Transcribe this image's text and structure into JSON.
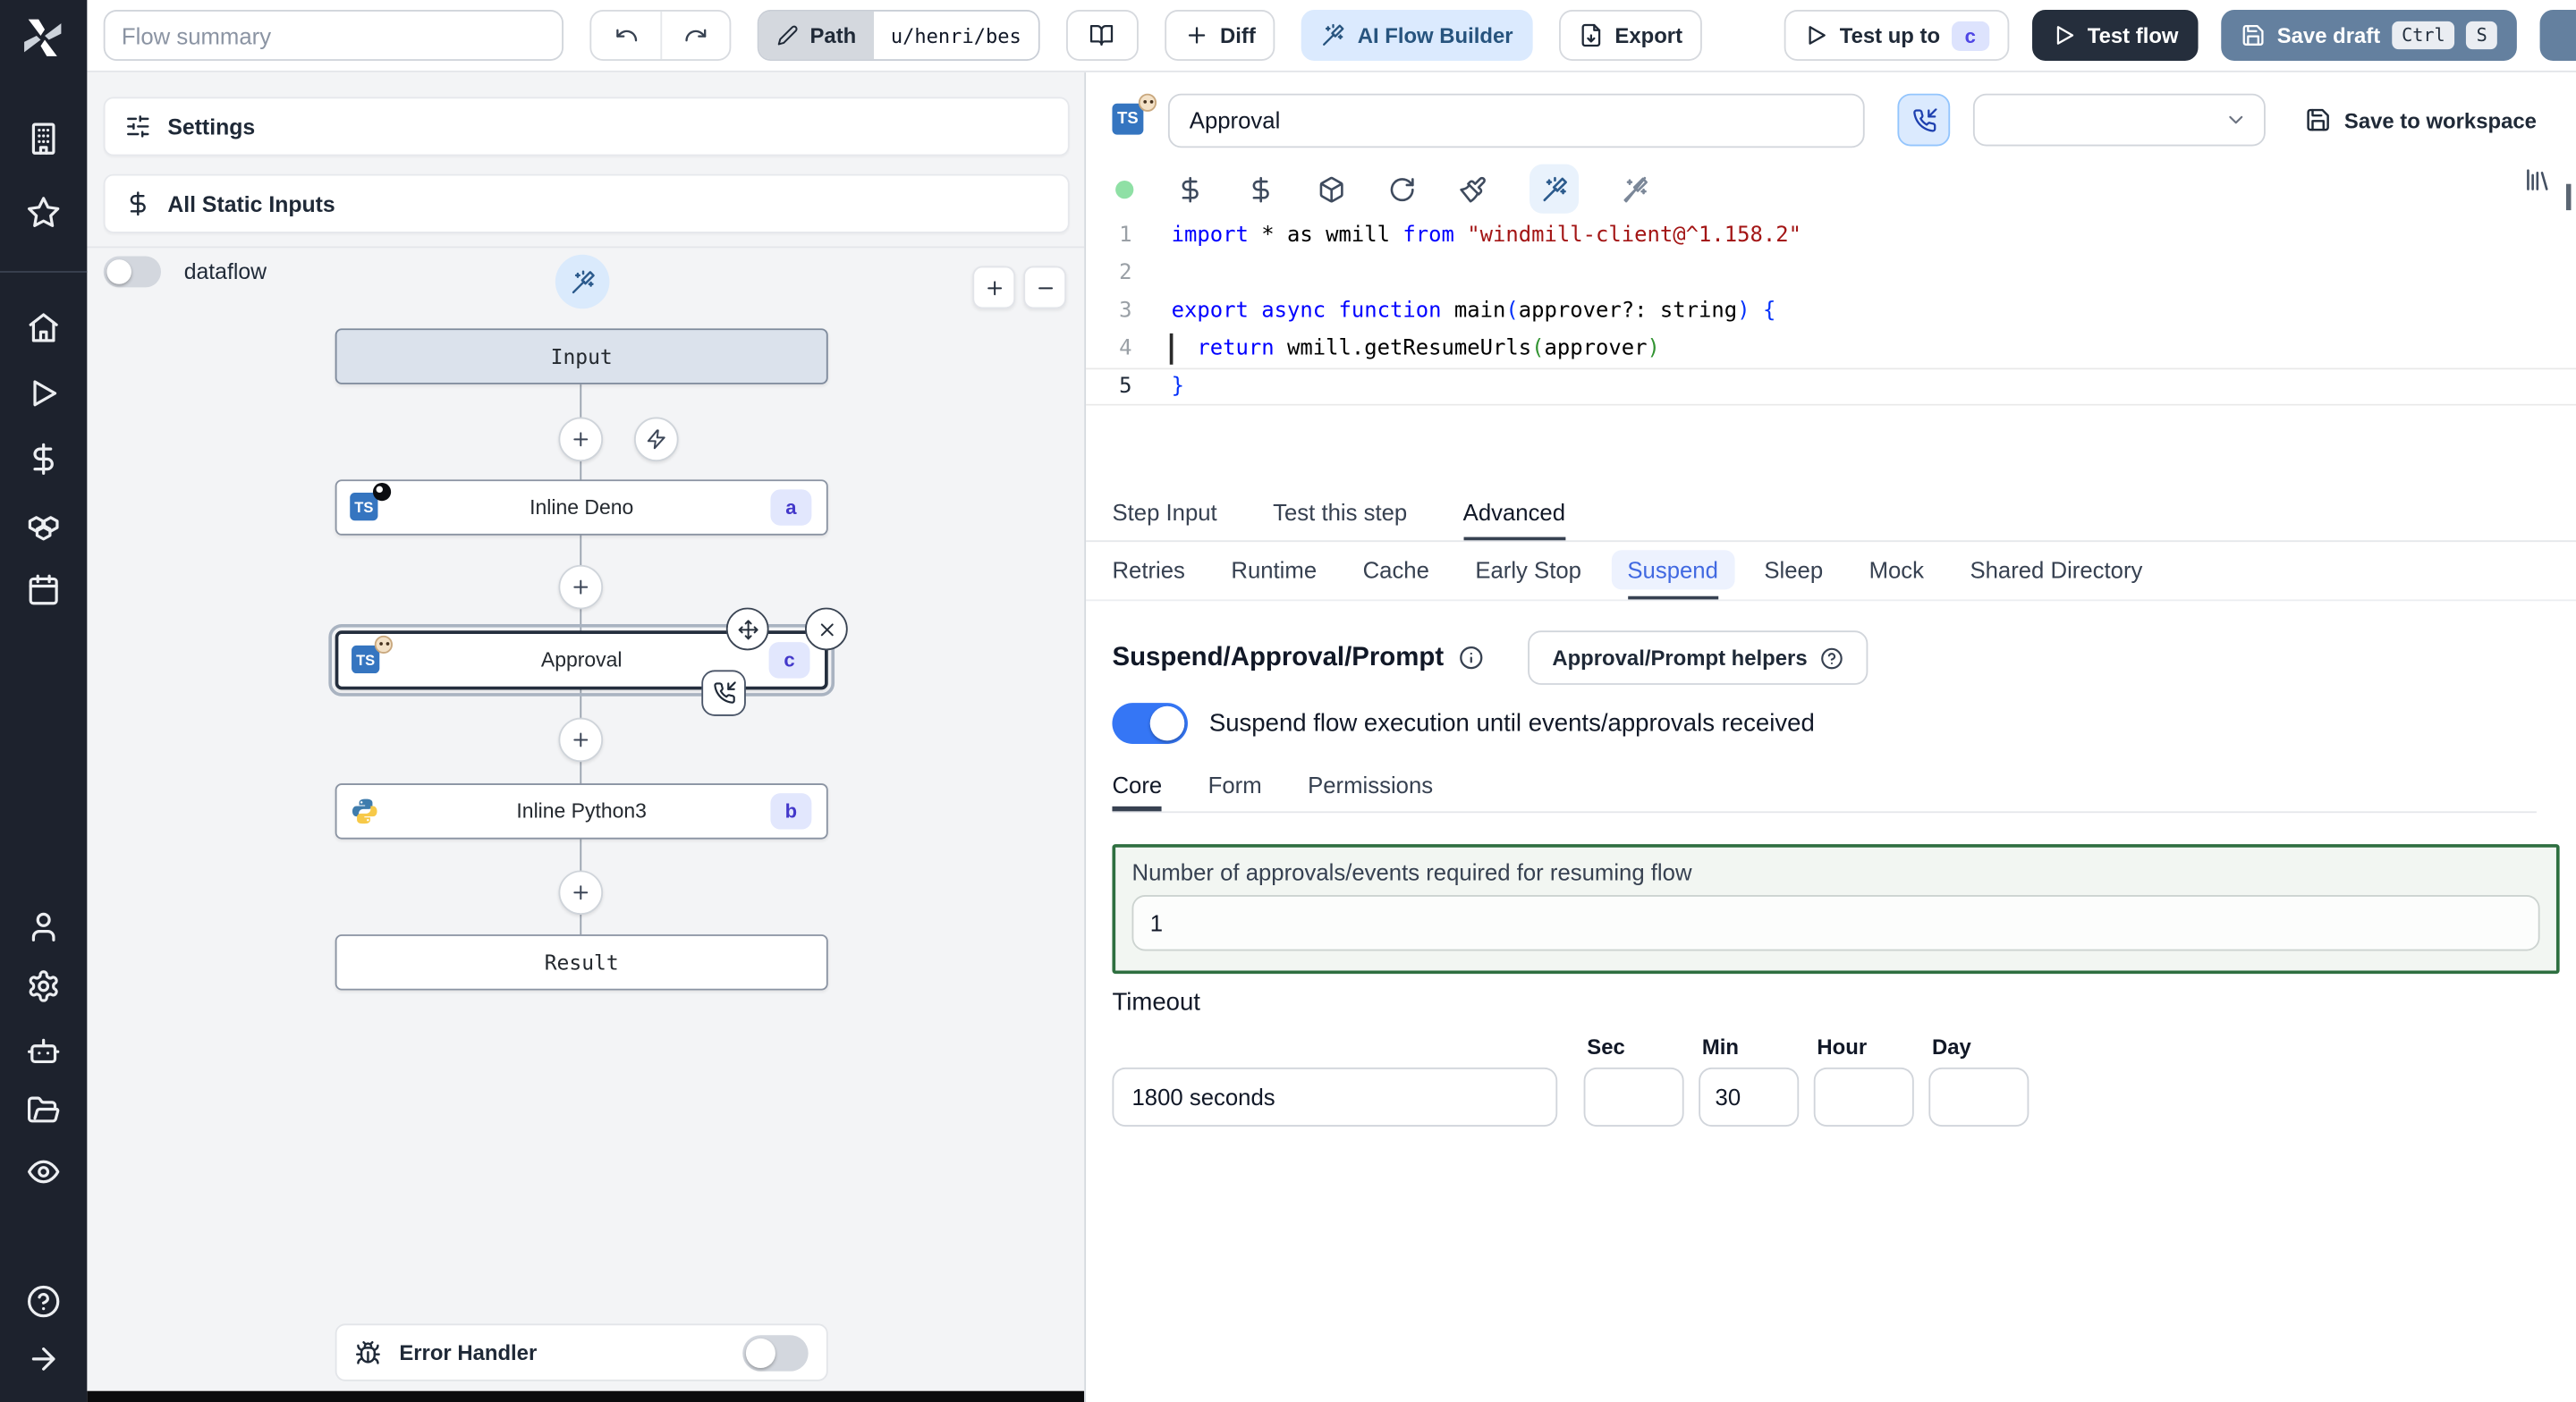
{
  "colors": {
    "sidebar_bg": "#1d222d",
    "accent_blue": "#3576f5",
    "ai_button_bg": "#dbeafe",
    "ai_button_text": "#27547e",
    "test_flow_bg": "#252e3c",
    "save_draft_bg": "#64809f",
    "badge_bg": "#e2e7fd",
    "badge_text": "#4338ca",
    "suspend_tab_text": "#4169e1",
    "approvals_box_border": "#2e6f40",
    "editor_status_dot": "#8fe0a5",
    "code_keyword": "#0000ff",
    "code_string": "#a31515"
  },
  "topbar": {
    "flow_summary_placeholder": "Flow summary",
    "path_label": "Path",
    "path_value": "u/henri/bes",
    "diff_label": "Diff",
    "ai_flow_builder_label": "AI Flow Builder",
    "export_label": "Export",
    "test_up_to_label": "Test up to",
    "test_up_to_badge": "c",
    "test_flow_label": "Test flow",
    "save_draft_label": "Save draft",
    "save_draft_kbd_1": "Ctrl",
    "save_draft_kbd_2": "S"
  },
  "flow_panel": {
    "settings_label": "Settings",
    "static_inputs_label": "All Static Inputs",
    "dataflow_label": "dataflow",
    "nodes": {
      "input_label": "Input",
      "deno_label": "Inline Deno",
      "deno_badge": "a",
      "approval_label": "Approval",
      "approval_badge": "c",
      "python_label": "Inline Python3",
      "python_badge": "b",
      "result_label": "Result"
    },
    "error_handler_label": "Error Handler"
  },
  "step_panel": {
    "title_value": "Approval",
    "save_to_workspace_label": "Save to workspace",
    "code": {
      "language": "typescript",
      "active_line": 5,
      "caret_line": 4,
      "lines": [
        [
          [
            "import",
            "k"
          ],
          [
            " * as wmill ",
            "p"
          ],
          [
            "from",
            "k"
          ],
          [
            " ",
            "p"
          ],
          [
            "\"windmill-client@^1.158.2\"",
            "s"
          ]
        ],
        [],
        [
          [
            "export",
            "k"
          ],
          [
            " ",
            "p"
          ],
          [
            "async",
            "k"
          ],
          [
            " ",
            "p"
          ],
          [
            "function",
            "k"
          ],
          [
            " main",
            "p"
          ],
          [
            "(",
            "b1"
          ],
          [
            "approver?: string",
            "p"
          ],
          [
            ")",
            "b1"
          ],
          [
            " ",
            "p"
          ],
          [
            "{",
            "b1"
          ]
        ],
        [
          [
            "  ",
            "p"
          ],
          [
            "return",
            "k"
          ],
          [
            " wmill.getResumeUrls",
            "p"
          ],
          [
            "(",
            "b2"
          ],
          [
            "approver",
            "p"
          ],
          [
            ")",
            "b2"
          ]
        ],
        [
          [
            "}",
            "b1"
          ]
        ]
      ]
    },
    "tabs": [
      "Step Input",
      "Test this step",
      "Advanced"
    ],
    "active_tab": "Advanced",
    "subtabs": [
      "Retries",
      "Runtime",
      "Cache",
      "Early Stop",
      "Suspend",
      "Sleep",
      "Mock",
      "Shared Directory"
    ],
    "active_subtab": "Suspend",
    "suspend": {
      "heading": "Suspend/Approval/Prompt",
      "helpers_button_label": "Approval/Prompt helpers",
      "toggle_label": "Suspend flow execution until events/approvals received",
      "toggle_on": true,
      "tabs": [
        "Core",
        "Form",
        "Permissions"
      ],
      "active_tab": "Core",
      "approvals_label": "Number of approvals/events required for resuming flow",
      "approvals_value": "1",
      "timeout_label": "Timeout",
      "timeout_value": "1800 seconds",
      "timeout_units": [
        {
          "label": "Sec",
          "value": ""
        },
        {
          "label": "Min",
          "value": "30"
        },
        {
          "label": "Hour",
          "value": ""
        },
        {
          "label": "Day",
          "value": ""
        }
      ]
    }
  }
}
